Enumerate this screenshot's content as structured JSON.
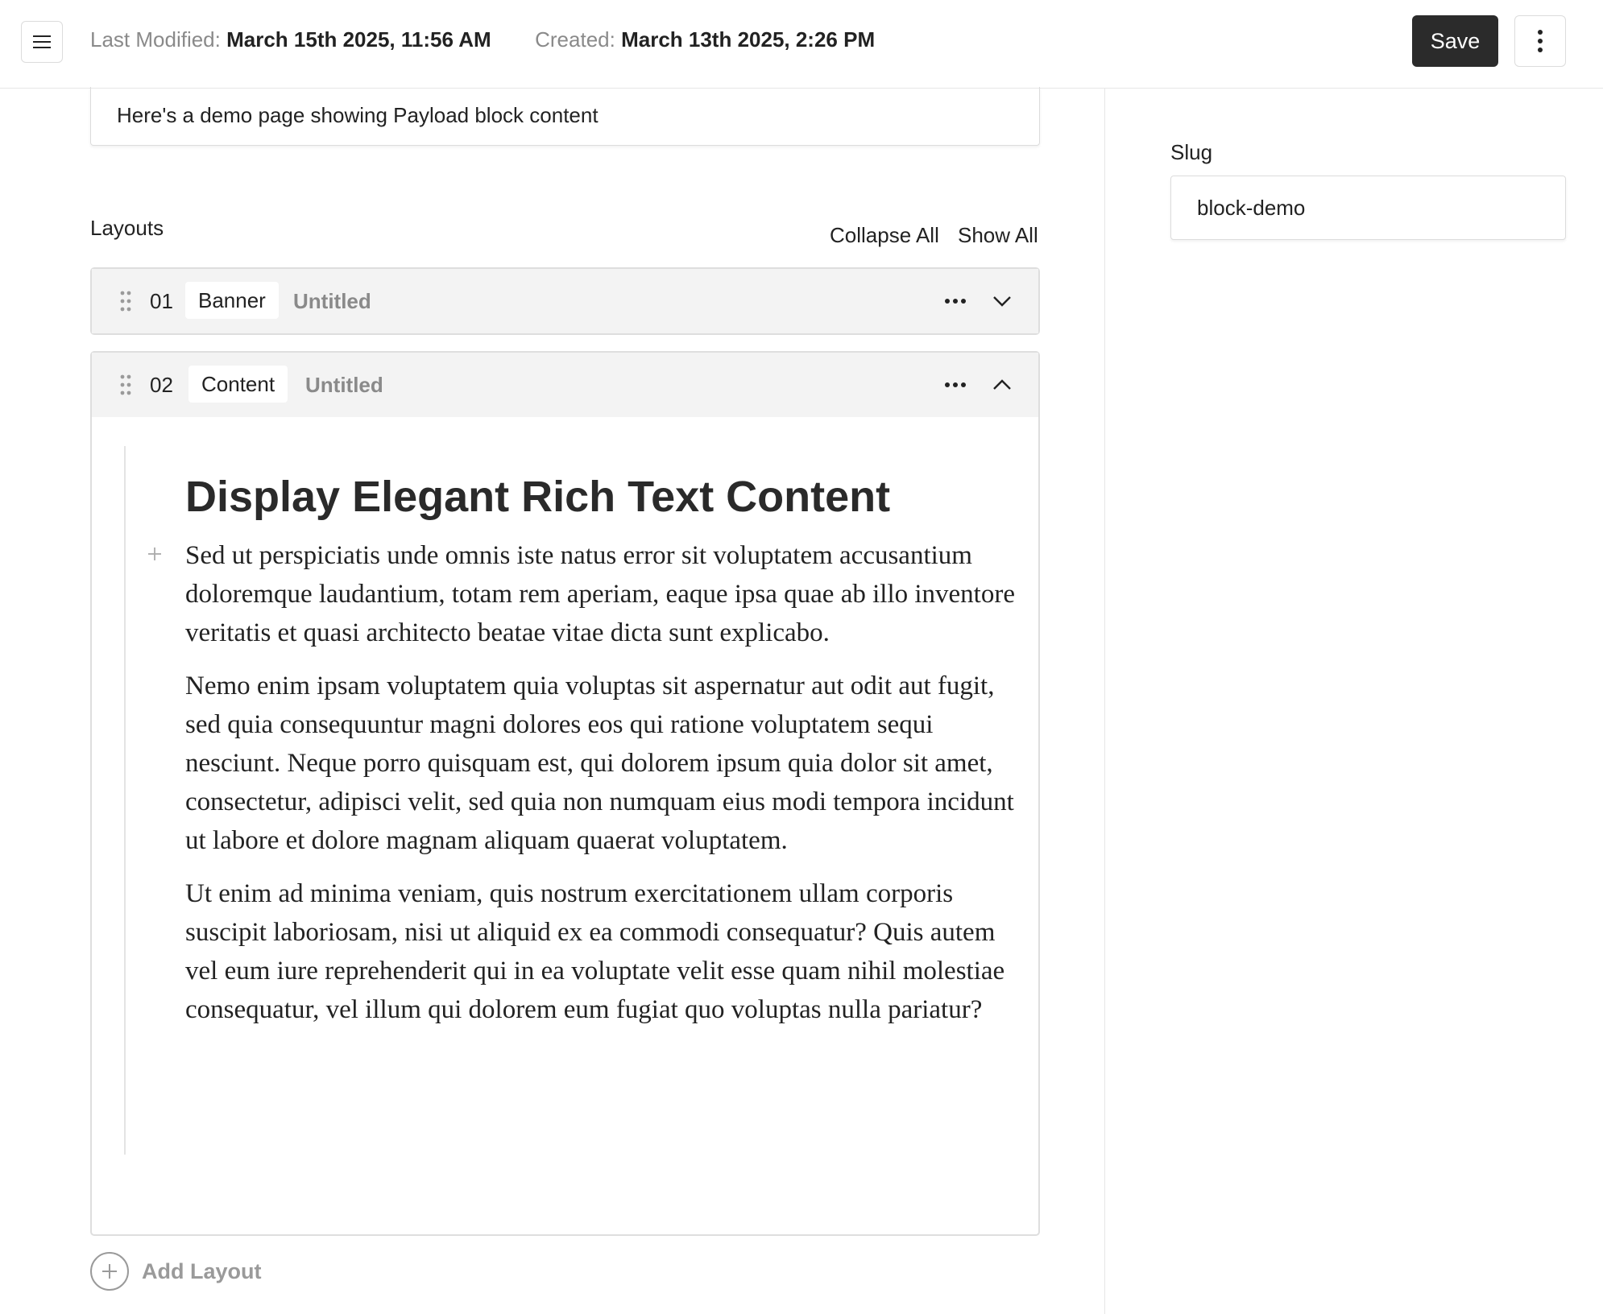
{
  "header": {
    "last_modified_label": "Last Modified:",
    "last_modified_value": "March 15th 2025, 11:56 AM",
    "created_label": "Created:",
    "created_value": "March 13th 2025, 2:26 PM",
    "save_label": "Save"
  },
  "main": {
    "description_value": "Here's a demo page showing Payload block content",
    "layouts_label": "Layouts",
    "collapse_all": "Collapse All",
    "show_all": "Show All",
    "blocks": [
      {
        "number": "01",
        "type": "Banner",
        "title": "Untitled"
      },
      {
        "number": "02",
        "type": "Content",
        "title": "Untitled"
      }
    ],
    "rich_text": {
      "heading": "Display Elegant Rich Text Content",
      "paragraphs": [
        "Sed ut perspiciatis unde omnis iste natus error sit voluptatem accusantium doloremque laudantium, totam rem aperiam, eaque ipsa quae ab illo inventore veritatis et quasi architecto beatae vitae dicta sunt explicabo.",
        "Nemo enim ipsam voluptatem quia voluptas sit aspernatur aut odit aut fugit, sed quia consequuntur magni dolores eos qui ratione voluptatem sequi nesciunt. Neque porro quisquam est, qui dolorem ipsum quia dolor sit amet, consectetur, adipisci velit, sed quia non numquam eius modi tempora incidunt ut labore et dolore magnam aliquam quaerat voluptatem.",
        "Ut enim ad minima veniam, quis nostrum exercitationem ullam corporis suscipit laboriosam, nisi ut aliquid ex ea commodi consequatur? Quis autem vel eum iure reprehenderit qui in ea voluptate velit esse quam nihil molestiae consequatur, vel illum qui dolorem eum fugiat quo voluptas nulla pariatur?"
      ]
    },
    "add_layout_label": "Add Layout"
  },
  "sidebar": {
    "slug_label": "Slug",
    "slug_value": "block-demo"
  },
  "icons": {
    "menu": "hamburger-icon",
    "more_vertical": "kebab-icon",
    "drag": "drag-handle-icon",
    "more_horizontal": "ellipsis-icon",
    "collapse": "chevron-up-icon",
    "expand": "chevron-down-icon",
    "add": "plus-icon"
  },
  "colors": {
    "primary_button": "#2b2b2b",
    "muted_text": "#8a8a8a",
    "border": "#dedede"
  }
}
